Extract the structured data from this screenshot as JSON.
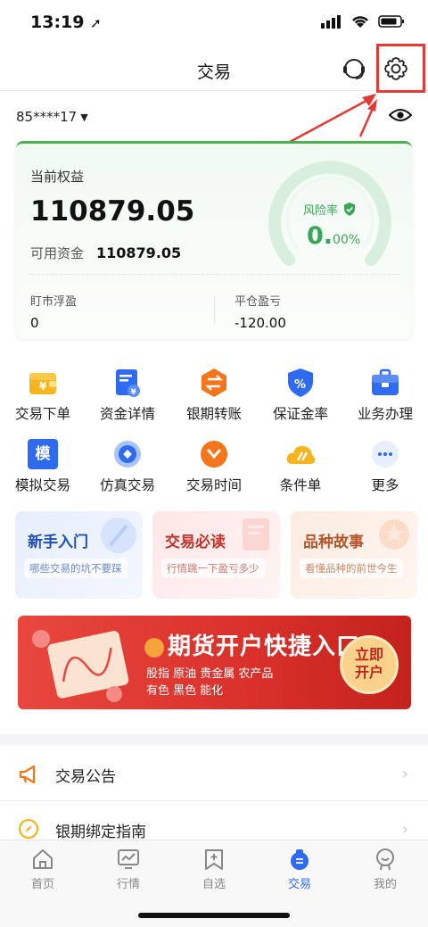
{
  "status": {
    "time": "13:19"
  },
  "nav": {
    "title": "交易"
  },
  "account": {
    "id": "85****17"
  },
  "equity": {
    "label": "当前权益",
    "value": "110879.05",
    "available_label": "可用资金",
    "available_value": "110879.05",
    "risk_label": "风险率",
    "risk_main": "0.",
    "risk_sub": "00%",
    "float_label": "盯市浮盈",
    "float_value": "0",
    "close_label": "平仓盈亏",
    "close_value": "-120.00"
  },
  "grid": {
    "row1": [
      "交易下单",
      "资金详情",
      "银期转账",
      "保证金率",
      "业务办理"
    ],
    "row2": [
      "模拟交易",
      "仿真交易",
      "交易时间",
      "条件单",
      "更多"
    ],
    "mock_icon_char": "模"
  },
  "promos": [
    {
      "title": "新手入门",
      "sub": "哪些交易的坑不要踩"
    },
    {
      "title": "交易必读",
      "sub": "行情跳一下盈亏多少"
    },
    {
      "title": "品种故事",
      "sub": "看懂品种的前世今生"
    }
  ],
  "banner": {
    "title": "期货开户快捷入口",
    "line1": "股指  原油  贵金属  农产品",
    "line2": "有色  黑色  能化",
    "btn1": "立即",
    "btn2": "开户"
  },
  "list": [
    {
      "label": "交易公告"
    },
    {
      "label": "银期绑定指南"
    }
  ],
  "tabs": [
    "首页",
    "行情",
    "自选",
    "交易",
    "我的"
  ],
  "colors": {
    "accent_blue": "#2f6bf0",
    "risk_green": "#3aa655",
    "banner_red": "#d9302a",
    "highlight_red": "#e53935"
  }
}
